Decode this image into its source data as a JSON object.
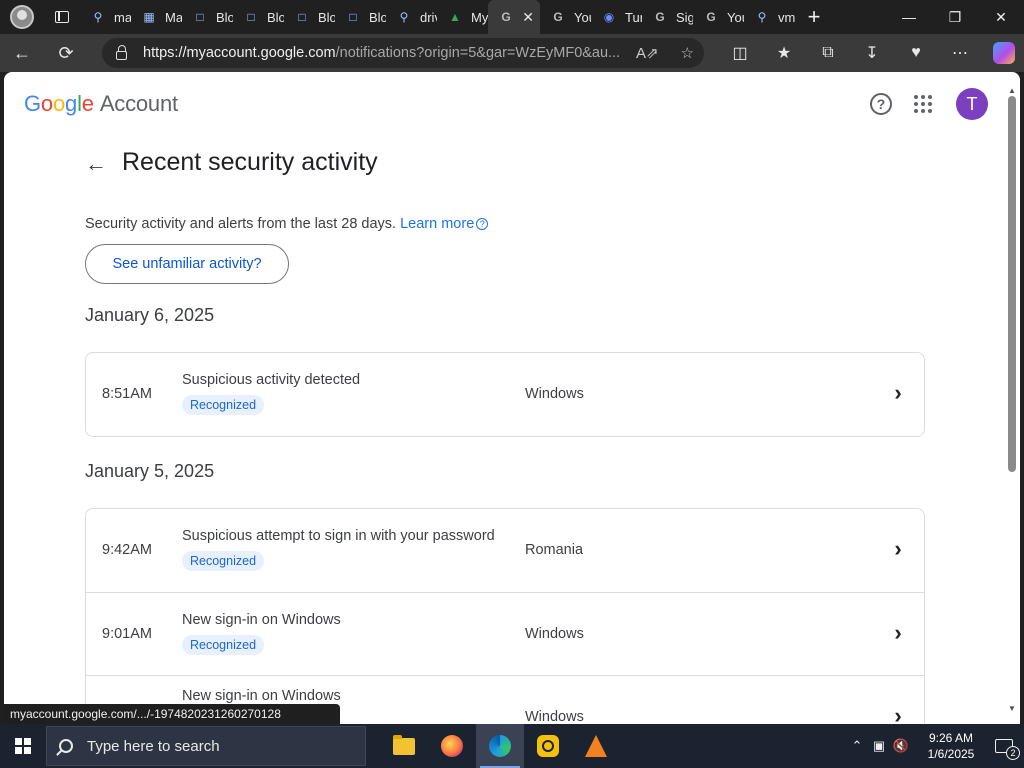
{
  "browser": {
    "tabs": [
      {
        "title": "ma",
        "icon": "search-icon"
      },
      {
        "title": "Ma",
        "icon": "building-icon"
      },
      {
        "title": "Blo",
        "icon": "page-icon"
      },
      {
        "title": "Blo",
        "icon": "page-icon"
      },
      {
        "title": "Blo",
        "icon": "page-icon"
      },
      {
        "title": "Blo",
        "icon": "page-icon"
      },
      {
        "title": "driv",
        "icon": "search-icon"
      },
      {
        "title": "My",
        "icon": "drive-icon"
      },
      {
        "title": "",
        "icon": "google-icon",
        "active": true
      },
      {
        "title": "You",
        "icon": "google-icon"
      },
      {
        "title": "Tur",
        "icon": "globe-icon"
      },
      {
        "title": "Sig",
        "icon": "google-icon"
      },
      {
        "title": "You",
        "icon": "google-icon"
      },
      {
        "title": "vm",
        "icon": "search-icon"
      }
    ],
    "url_host": "https://myaccount.google.com",
    "url_rest": "/notifications?origin=5&gar=WzEyMF0&au...",
    "status_tooltip": "myaccount.google.com/.../-1974820231260270128"
  },
  "header": {
    "logo_letters": [
      "G",
      "o",
      "o",
      "g",
      "l",
      "e"
    ],
    "logo_suffix": "Account",
    "avatar_letter": "T",
    "help_label": "?"
  },
  "main": {
    "title": "Recent security activity",
    "subtitle": "Security activity and alerts from the last 28 days.",
    "learn_more": "Learn more",
    "unfamiliar_button": "See unfamiliar activity?",
    "groups": [
      {
        "date": "January 6, 2025",
        "events": [
          {
            "time": "8:51AM",
            "title": "Suspicious activity detected",
            "badge": "Recognized",
            "location": "Windows"
          }
        ]
      },
      {
        "date": "January 5, 2025",
        "events": [
          {
            "time": "9:42AM",
            "title": "Suspicious attempt to sign in with your password",
            "badge": "Recognized",
            "location": "Romania"
          },
          {
            "time": "9:01AM",
            "title": "New sign-in on Windows",
            "badge": "Recognized",
            "location": "Windows"
          },
          {
            "time": "",
            "title": "New sign-in on Windows",
            "badge": "",
            "location": "Windows"
          }
        ]
      }
    ]
  },
  "taskbar": {
    "search_placeholder": "Type here to search",
    "clock_time": "9:26 AM",
    "clock_date": "1/6/2025",
    "notification_count": "2",
    "apps": [
      "file-explorer-icon",
      "firefox-icon",
      "edge-icon",
      "app-yellow-icon",
      "vlc-icon"
    ]
  }
}
